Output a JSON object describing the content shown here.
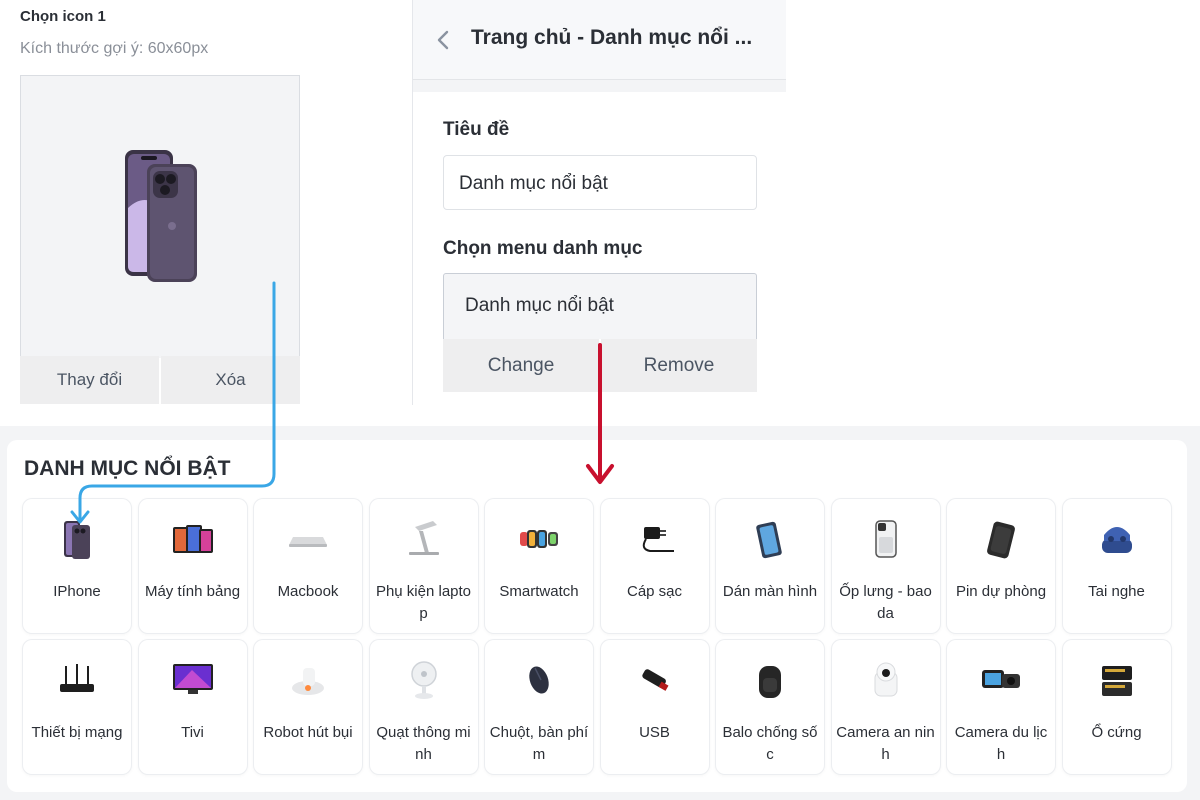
{
  "icon_panel": {
    "title": "Chọn icon 1",
    "hint": "Kích thước gợi ý: 60x60px",
    "change_label": "Thay đổi",
    "delete_label": "Xóa"
  },
  "settings": {
    "header_title": "Trang chủ - Danh mục nổi ...",
    "title_label": "Tiêu đề",
    "title_value": "Danh mục nổi bật",
    "menu_label": "Chọn menu danh mục",
    "menu_value": "Danh mục nổi bật",
    "change_label": "Change",
    "remove_label": "Remove"
  },
  "section": {
    "title": "DANH MỤC NỔI BẬT",
    "items": [
      {
        "label": "IPhone",
        "icon": "iphone-icon"
      },
      {
        "label": "Máy tính bảng",
        "icon": "tablet-icon"
      },
      {
        "label": "Macbook",
        "icon": "macbook-icon"
      },
      {
        "label": "Phụ kiện laptop",
        "icon": "laptop-stand-icon"
      },
      {
        "label": "Smartwatch",
        "icon": "smartwatch-icon"
      },
      {
        "label": "Cáp sạc",
        "icon": "charger-icon"
      },
      {
        "label": "Dán màn hình",
        "icon": "screen-protector-icon"
      },
      {
        "label": "Ốp lưng - bao da",
        "icon": "phone-case-icon"
      },
      {
        "label": "Pin dự phòng",
        "icon": "power-bank-icon"
      },
      {
        "label": "Tai nghe",
        "icon": "earbuds-icon"
      },
      {
        "label": "Thiết bị mạng",
        "icon": "router-icon"
      },
      {
        "label": "Tivi",
        "icon": "tv-icon"
      },
      {
        "label": "Robot hút bụi",
        "icon": "robot-vacuum-icon"
      },
      {
        "label": "Quạt thông minh",
        "icon": "fan-icon"
      },
      {
        "label": "Chuột, bàn phím",
        "icon": "mouse-icon"
      },
      {
        "label": "USB",
        "icon": "usb-icon"
      },
      {
        "label": "Balo chống sốc",
        "icon": "backpack-icon"
      },
      {
        "label": "Camera an ninh",
        "icon": "security-camera-icon"
      },
      {
        "label": "Camera du lịch",
        "icon": "action-camera-icon"
      },
      {
        "label": "Ổ cứng",
        "icon": "hard-drive-icon"
      }
    ]
  },
  "colors": {
    "arrow_blue": "#3aa7e6",
    "arrow_red": "#c8102e"
  }
}
